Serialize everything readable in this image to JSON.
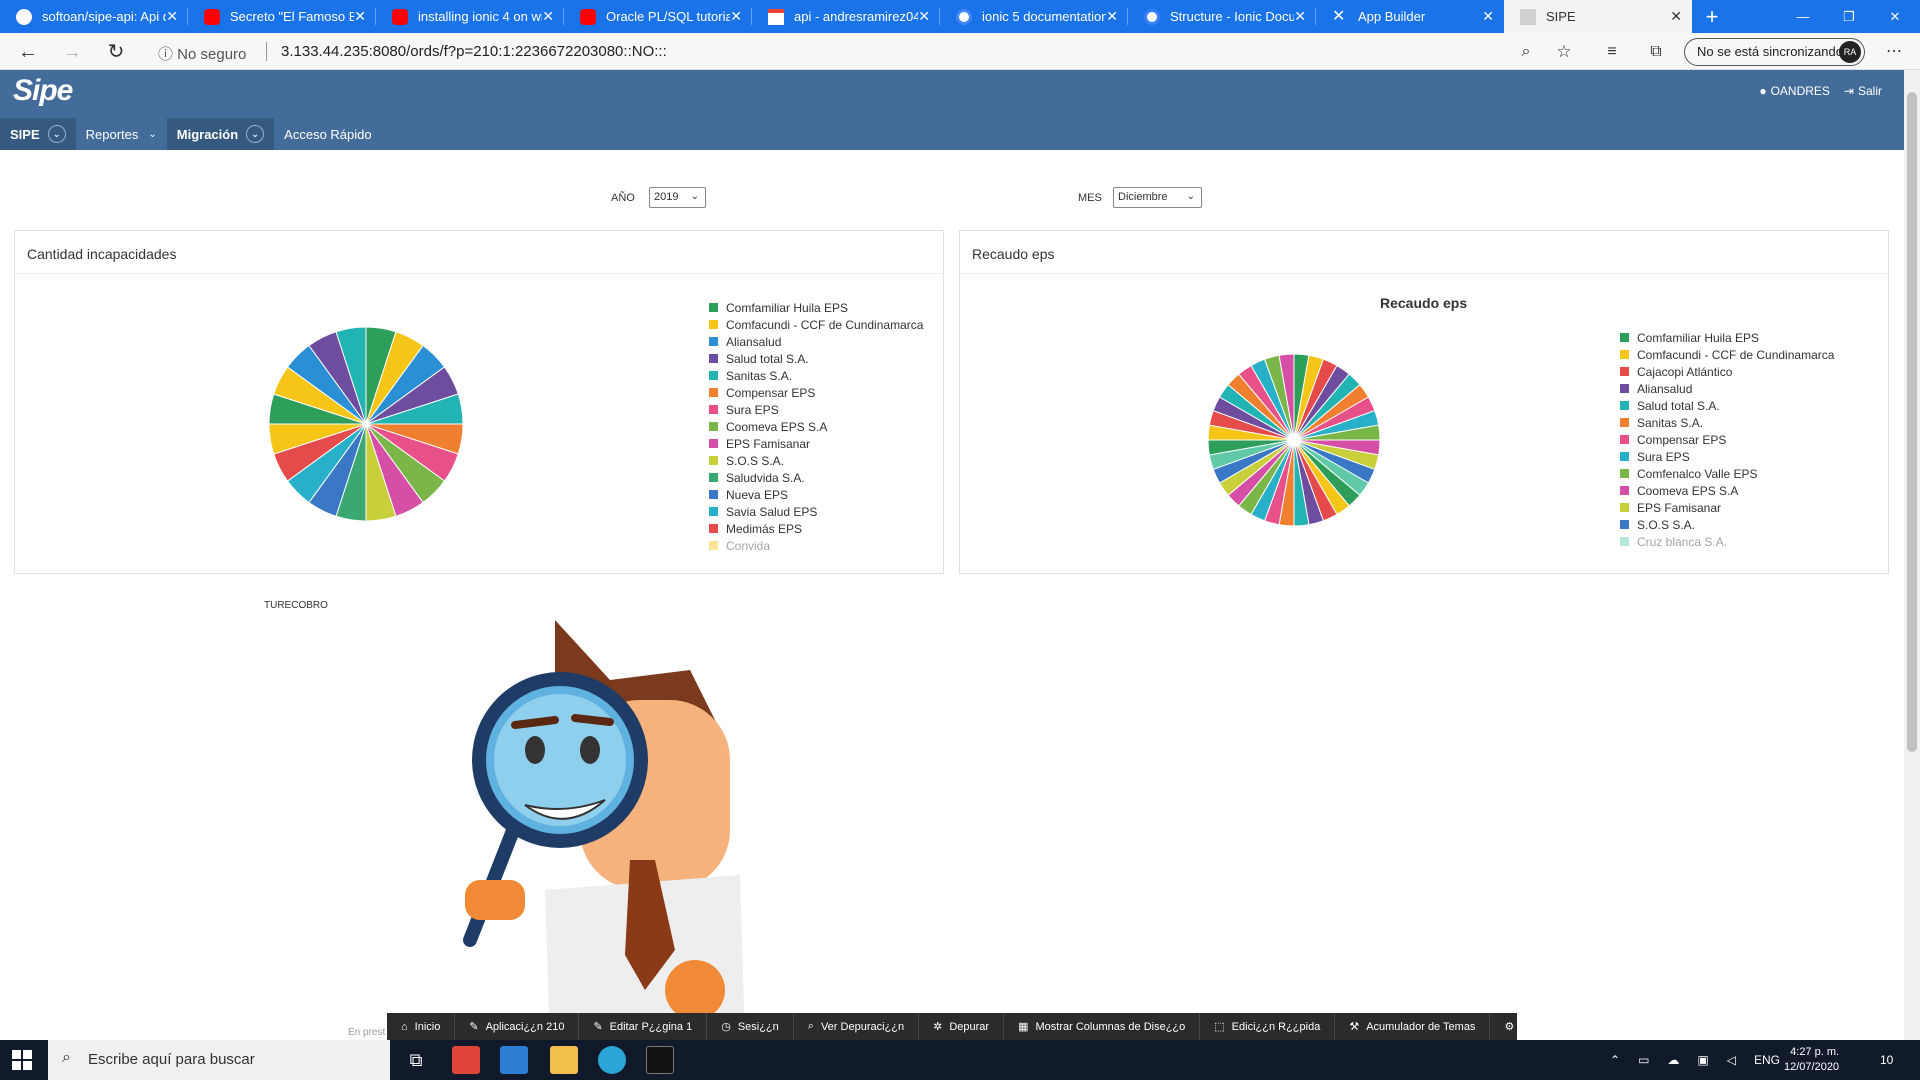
{
  "browser": {
    "tabs": [
      {
        "label": "softoan/sipe-api: Api d",
        "icon": "github-icon"
      },
      {
        "label": "Secreto \"El Famoso Bib",
        "icon": "youtube-icon"
      },
      {
        "label": "installing ionic 4 on wi",
        "icon": "youtube-icon"
      },
      {
        "label": "Oracle PL/SQL tutorial",
        "icon": "youtube-icon"
      },
      {
        "label": "api - andresramirez042",
        "icon": "gmail-icon"
      },
      {
        "label": "ionic 5 documentation",
        "icon": "google-icon"
      },
      {
        "label": "Structure - Ionic Docum",
        "icon": "ionic-icon"
      },
      {
        "label": "App Builder",
        "icon": "app-builder-icon"
      },
      {
        "label": "SIPE",
        "icon": "page-icon"
      }
    ],
    "insecure_label": "No seguro",
    "url": "3.133.44.235:8080/ords/f?p=210:1:2236672203080::NO:::",
    "sync_label": "No se está sincronizando",
    "avatar_initials": "RA"
  },
  "app": {
    "logo": "Sipe",
    "user": "OANDRES",
    "logout": "Salir",
    "menu": [
      {
        "label": "SIPE"
      },
      {
        "label": "Reportes"
      },
      {
        "label": "Migración"
      },
      {
        "label": "Acceso Rápido"
      }
    ]
  },
  "filters": {
    "year_label": "AÑO",
    "year_value": "2019",
    "month_label": "MES",
    "month_value": "Diciembre"
  },
  "panels": {
    "left_title": "Cantidad incapacidades",
    "right_title": "Recaudo eps",
    "right_chart_title": "Recaudo eps"
  },
  "chart_data": [
    {
      "type": "pie",
      "title": "Cantidad incapacidades",
      "legend": [
        "Comfamiliar Huila EPS",
        "Comfacundi - CCF de Cundinamarca",
        "Aliansalud",
        "Salud total S.A.",
        "Sanitas S.A.",
        "Compensar EPS",
        "Sura EPS",
        "Coomeva EPS S.A",
        "EPS Famisanar",
        "S.O.S S.A.",
        "Saludvida S.A.",
        "Nueva EPS",
        "Savia Salud EPS",
        "Medimás EPS",
        "Convida"
      ],
      "colors": [
        "#2e9e5b",
        "#f5c518",
        "#2b8fd6",
        "#6e4c9e",
        "#22b3b3",
        "#f07f2f",
        "#e8508a",
        "#7ab648",
        "#d64fa6",
        "#c8cf3a",
        "#3ba872",
        "#3a77c4",
        "#27b0c8",
        "#e54b4b",
        "#f5c518"
      ],
      "slices": 20,
      "legend_position": "right"
    },
    {
      "type": "pie",
      "title": "Recaudo eps",
      "legend": [
        "Comfamiliar Huila EPS",
        "Comfacundi - CCF de Cundinamarca",
        "Cajacopi Atlántico",
        "Aliansalud",
        "Salud total S.A.",
        "Sanitas S.A.",
        "Compensar EPS",
        "Sura EPS",
        "Comfenalco Valle EPS",
        "Coomeva EPS S.A",
        "EPS Famisanar",
        "S.O.S S.A.",
        "Cruz blanca S.A."
      ],
      "colors": [
        "#2e9e5b",
        "#f5c518",
        "#e54b4b",
        "#6e4c9e",
        "#22b3b3",
        "#f07f2f",
        "#e8508a",
        "#27b0c8",
        "#7ab648",
        "#d64fa6",
        "#c8cf3a",
        "#3a77c4",
        "#5fc9a8"
      ],
      "slices": 36,
      "legend_position": "right"
    }
  ],
  "section_label": "TURECOBRO",
  "faint_text": "En prest",
  "devbar": [
    {
      "label": "Inicio",
      "icon": "home-icon"
    },
    {
      "label": "Aplicaci¿¿n 210",
      "icon": "edit-icon"
    },
    {
      "label": "Editar P¿¿gina 1",
      "icon": "edit-icon"
    },
    {
      "label": "Sesi¿¿n",
      "icon": "clock-icon"
    },
    {
      "label": "Ver Depuraci¿¿n",
      "icon": "debug-view-icon"
    },
    {
      "label": "Depurar",
      "icon": "bug-icon"
    },
    {
      "label": "Mostrar Columnas de Dise¿¿o",
      "icon": "grid-icon"
    },
    {
      "label": "Edici¿¿n R¿¿pida",
      "icon": "quick-edit-icon"
    },
    {
      "label": "Acumulador de Temas",
      "icon": "theme-icon"
    },
    {
      "label": "",
      "icon": "gear-icon"
    }
  ],
  "taskbar": {
    "search_placeholder": "Escribe aquí para buscar",
    "lang": "ENG",
    "time": "4:27 p. m.",
    "date": "12/07/2020",
    "notifications": "10"
  }
}
